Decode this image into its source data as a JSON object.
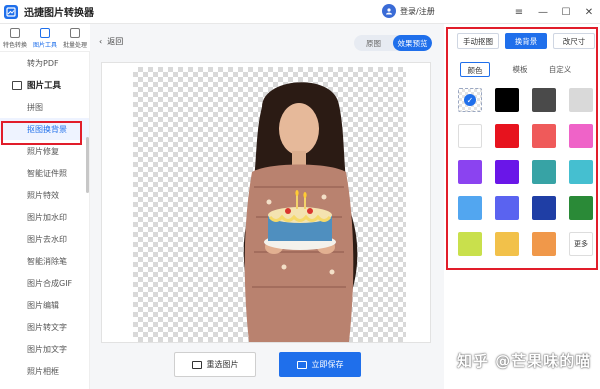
{
  "app": {
    "title": "迅捷图片转换器",
    "user_label": "登录/注册"
  },
  "window_controls": [
    "menu-icon",
    "minimize-icon",
    "maximize-icon",
    "close-icon"
  ],
  "rail": [
    {
      "label": "特色转换",
      "icon": "convert-icon",
      "active": false
    },
    {
      "label": "图片工具",
      "icon": "image-tools-icon",
      "active": true
    },
    {
      "label": "批量处理",
      "icon": "batch-icon",
      "active": false
    }
  ],
  "menu": {
    "pre_item": "转为PDF",
    "section": "图片工具",
    "items": [
      "拼图",
      "抠图换背景",
      "照片修复",
      "智能证件照",
      "照片特效",
      "图片加水印",
      "图片去水印",
      "智能消除笔",
      "图片合成GIF",
      "图片编辑",
      "图片转文字",
      "图片加文字",
      "照片相框"
    ],
    "active_index": 1
  },
  "center": {
    "back_label": "返回",
    "view_toggle": {
      "original": "原图",
      "preview": "效果预览",
      "active": "preview"
    },
    "reselect_label": "重选图片",
    "save_label": "立即保存"
  },
  "right_panel": {
    "tabs": [
      "手动抠图",
      "换背景",
      "改尺寸"
    ],
    "active_tab": 1,
    "subtabs": [
      "颜色",
      "模板",
      "自定义"
    ],
    "active_subtab": 0,
    "swatches": [
      "transparent",
      "#000000",
      "#4a4a4a",
      "#d9d9d9",
      "#ffffff",
      "#e7131e",
      "#ef5a5a",
      "#ef63c8",
      "#8b43f0",
      "#6a16e8",
      "#37a3a5",
      "#45bfd0",
      "#52a6f0",
      "#5a63f0",
      "#1f3ea5",
      "#2a8a37",
      "#c9e04c",
      "#f2c14a",
      "#f0984a"
    ],
    "more_label": "更多"
  },
  "watermark": "知乎 @芒果味的喵"
}
